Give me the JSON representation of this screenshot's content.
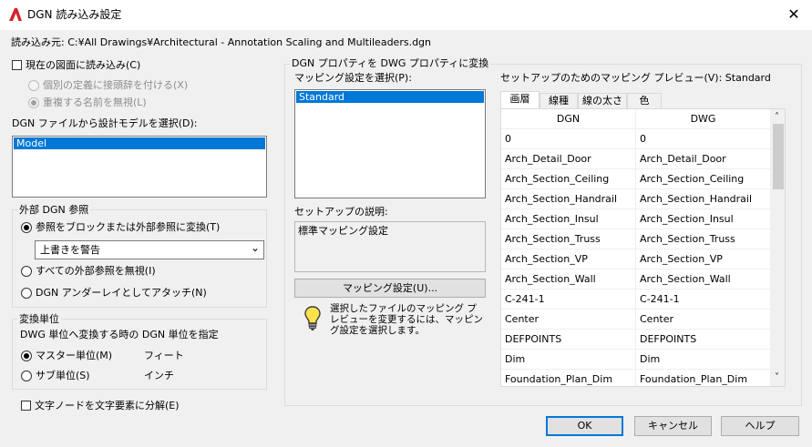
{
  "window": {
    "title": "DGN 読み込み設定",
    "close_symbol": "✕"
  },
  "source": {
    "label": "読み込み元: ",
    "path": "C:¥All Drawings¥Architectural - Annotation Scaling and Multileaders.dgn"
  },
  "import_current": {
    "label": "現在の図面に読み込み(C)",
    "checked": false
  },
  "options": [
    {
      "label": "個別の定義に接頭辞を付ける(X)",
      "selected": false,
      "enabled": false
    },
    {
      "label": "重複する名前を無視(L)",
      "selected": true,
      "enabled": false
    }
  ],
  "design_model": {
    "label": "DGN ファイルから設計モデルを選択(D):",
    "items": [
      "Model"
    ],
    "selected_index": 0
  },
  "external_ref": {
    "title": "外部 DGN 参照",
    "options": [
      {
        "label": "参照をブロックまたは外部参照に変換(T)",
        "selected": true
      },
      {
        "label": "すべての外部参照を無視(I)",
        "selected": false
      },
      {
        "label": "DGN アンダーレイとしてアタッチ(N)",
        "selected": false
      }
    ],
    "combo_value": "上書きを警告",
    "combo_arrow": "⌄"
  },
  "units": {
    "title": "変換単位",
    "description": "DWG 単位へ変換する時の DGN 単位を指定",
    "options": [
      {
        "label": "マスター単位(M)",
        "unit": "フィート",
        "selected": true
      },
      {
        "label": "サブ単位(S)",
        "unit": "インチ",
        "selected": false
      }
    ]
  },
  "explode_text": {
    "label": "文字ノードを文字要素に分解(E)",
    "checked": false
  },
  "mapping": {
    "group_title": "DGN プロパティを DWG プロパティに変換",
    "select_label": "マッピング設定を選択(P):",
    "setups": [
      "Standard"
    ],
    "selected_index": 0,
    "description_label": "セットアップの説明:",
    "description": "標準マッピング設定",
    "button_label": "マッピング設定(U)...",
    "hint": "選択したファイルのマッピング プレビューを変更するには、マッピング設定を選択します。"
  },
  "preview": {
    "label": "セットアップのためのマッピング プレビュー(V): Standard",
    "tabs": [
      "画層",
      "線種",
      "線の太さ",
      "色"
    ],
    "active_tab": 0,
    "columns": [
      "DGN",
      "DWG"
    ],
    "rows": [
      [
        "0",
        "0"
      ],
      [
        "Arch_Detail_Door",
        "Arch_Detail_Door"
      ],
      [
        "Arch_Section_Ceiling",
        "Arch_Section_Ceiling"
      ],
      [
        "Arch_Section_Handrail",
        "Arch_Section_Handrail"
      ],
      [
        "Arch_Section_Insul",
        "Arch_Section_Insul"
      ],
      [
        "Arch_Section_Truss",
        "Arch_Section_Truss"
      ],
      [
        "Arch_Section_VP",
        "Arch_Section_VP"
      ],
      [
        "Arch_Section_Wall",
        "Arch_Section_Wall"
      ],
      [
        "C-241-1",
        "C-241-1"
      ],
      [
        "Center",
        "Center"
      ],
      [
        "DEFPOINTS",
        "DEFPOINTS"
      ],
      [
        "Dim",
        "Dim"
      ],
      [
        "Foundation_Plan_Dim",
        "Foundation_Plan_Dim"
      ]
    ],
    "scroll_up": "˄",
    "scroll_down": "˅"
  },
  "buttons": {
    "ok": "OK",
    "cancel": "キャンセル",
    "help": "ヘルプ"
  },
  "colors": {
    "accent": "#0078d7",
    "app_icon": "#d2232a"
  }
}
